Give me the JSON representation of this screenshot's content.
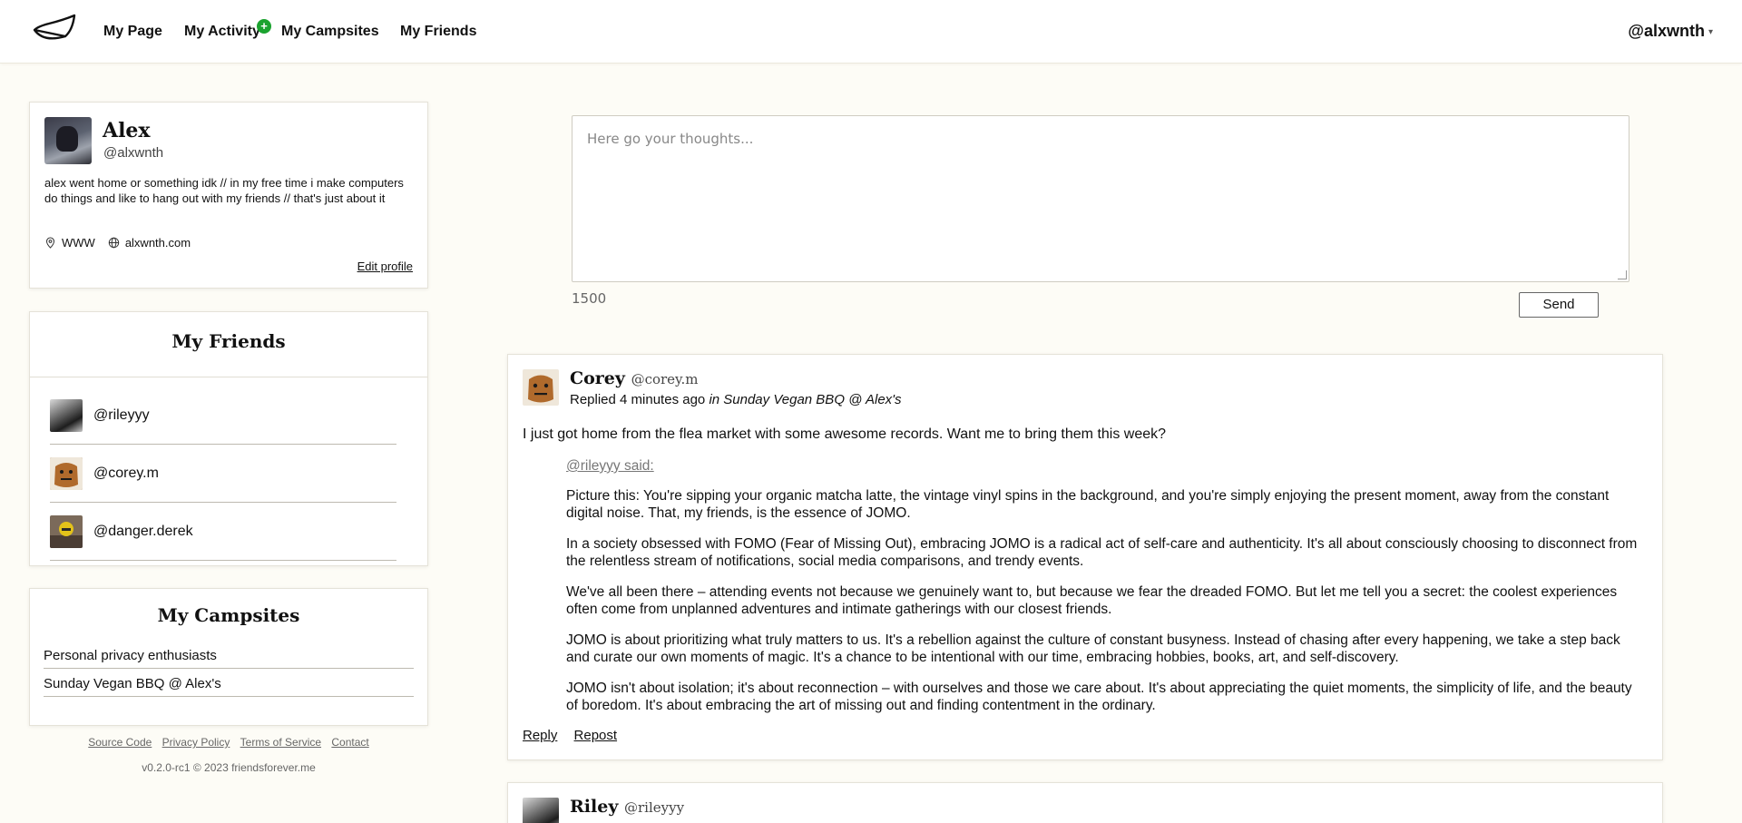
{
  "nav": {
    "links": [
      "My Page",
      "My Activity",
      "My Campsites",
      "My Friends"
    ],
    "activity_badge": "+",
    "user_handle": "@alxwnth",
    "caret": "▾"
  },
  "profile": {
    "name": "Alex",
    "handle": "@alxwnth",
    "bio": "alex went home or something idk // in my free time i make computers do things and like to hang out with my friends // that's just about it",
    "location": "WWW",
    "website": "alxwnth.com",
    "edit_label": "Edit profile"
  },
  "friends": {
    "title": "My Friends",
    "items": [
      "@rileyyy",
      "@corey.m",
      "@danger.derek"
    ]
  },
  "campsites": {
    "title": "My Campsites",
    "items": [
      "Personal privacy enthusiasts",
      "Sunday Vegan BBQ @ Alex's"
    ]
  },
  "footer": {
    "links": [
      "Source Code",
      "Privacy Policy",
      "Terms of Service",
      "Contact"
    ],
    "version": "v0.2.0-rc1 © 2023 friendsforever.me"
  },
  "composer": {
    "placeholder": "Here go your thoughts...",
    "char_count": "1500",
    "send_label": "Send"
  },
  "posts": [
    {
      "name": "Corey",
      "handle": "@corey.m",
      "meta_prefix": "Replied 4 minutes ago",
      "meta_place": "in Sunday Vegan BBQ @ Alex's",
      "body": "I just got home from the flea market with some awesome records. Want me to bring them this week?",
      "quote_author": "@rileyyy said:",
      "quote_paragraphs": [
        "Picture this: You're sipping your organic matcha latte, the vintage vinyl spins in the background, and you're simply enjoying the present moment, away from the constant digital noise. That, my friends, is the essence of JOMO.",
        "In a society obsessed with FOMO (Fear of Missing Out), embracing JOMO is a radical act of self-care and authenticity. It's all about consciously choosing to disconnect from the relentless stream of notifications, social media comparisons, and trendy events.",
        "We've all been there – attending events not because we genuinely want to, but because we fear the dreaded FOMO. But let me tell you a secret: the coolest experiences often come from unplanned adventures and intimate gatherings with our closest friends.",
        "JOMO is about prioritizing what truly matters to us. It's a rebellion against the culture of constant busyness. Instead of chasing after every happening, we take a step back and curate our own moments of magic. It's a chance to be intentional with our time, embracing hobbies, books, art, and self-discovery.",
        "JOMO isn't about isolation; it's about reconnection – with ourselves and those we care about. It's about appreciating the quiet moments, the simplicity of life, and the beauty of boredom. It's about embracing the art of missing out and finding contentment in the ordinary."
      ],
      "reply_label": "Reply",
      "repost_label": "Repost"
    },
    {
      "name": "Riley",
      "handle": "@rileyyy"
    }
  ]
}
